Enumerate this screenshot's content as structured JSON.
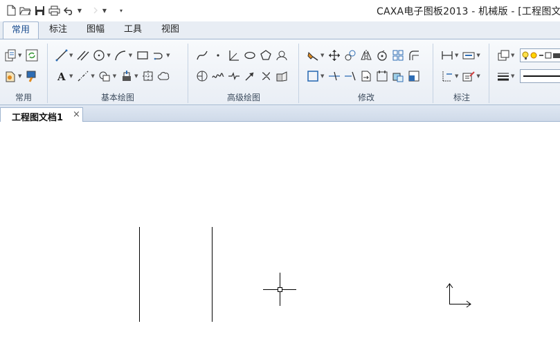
{
  "window": {
    "title": "CAXA电子图板2013 - 机械版 - [工程图文"
  },
  "ribbon_tabs": [
    {
      "label": "常用",
      "active": true
    },
    {
      "label": "标注",
      "active": false
    },
    {
      "label": "图幅",
      "active": false
    },
    {
      "label": "工具",
      "active": false
    },
    {
      "label": "视图",
      "active": false
    }
  ],
  "ribbon_groups": {
    "common": "常用",
    "basic_draw": "基本绘图",
    "advanced_draw": "高级绘图",
    "modify": "修改",
    "annotate": "标注"
  },
  "document_tab": {
    "label": "工程图文档1",
    "close": "×"
  },
  "colors": {
    "accent": "#1d4f91",
    "ribbon_border": "#9fb4cf",
    "icon_blue": "#2e6db4",
    "icon_green": "#3a9a3a",
    "icon_orange": "#e08a1e"
  }
}
